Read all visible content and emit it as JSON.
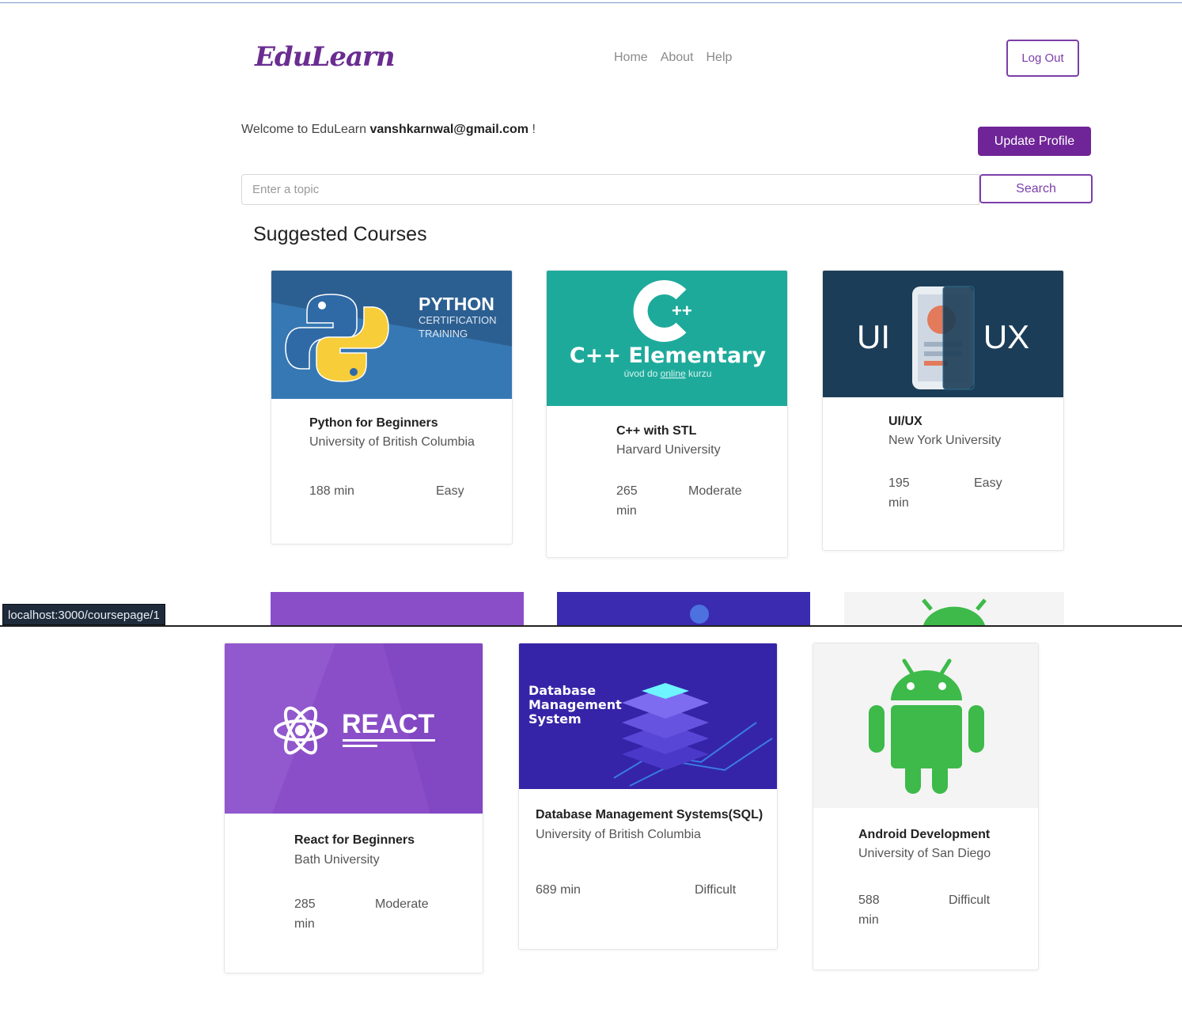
{
  "header": {
    "logo": "EduLearn",
    "nav": [
      "Home",
      "About",
      "Help"
    ],
    "logout_label": "Log Out"
  },
  "welcome": {
    "prefix": "Welcome to EduLearn ",
    "email": "vanshkarnwal@gmail.com",
    "suffix": " !"
  },
  "update_profile_label": "Update Profile",
  "search": {
    "placeholder": "Enter a topic",
    "button_label": "Search"
  },
  "section_title": "Suggested Courses",
  "status_url": "localhost:3000/coursepage/1",
  "courses": [
    {
      "title": "Python for Beginners",
      "university": "University of British Columbia",
      "duration": "188 min",
      "level": "Easy",
      "thumb": {
        "heading": "PYTHON",
        "line1": "CERTIFICATION",
        "line2": "TRAINING",
        "bg": "#2f6aa6"
      }
    },
    {
      "title": "C++ with STL",
      "university": "Harvard University",
      "duration": "265 min",
      "level": "Moderate",
      "thumb": {
        "heading": "C++ Elementary",
        "subtitle_prefix": "úvod do ",
        "subtitle_link": "online",
        "subtitle_suffix": " kurzu",
        "bg": "#1fa99b"
      }
    },
    {
      "title": "UI/UX",
      "university": "New York University",
      "duration": "195 min",
      "level": "Easy",
      "thumb": {
        "left": "UI",
        "right": "UX",
        "bg": "#1c3d57"
      }
    },
    {
      "title": "React for Beginners",
      "university": "Bath University",
      "duration": "285 min",
      "level": "Moderate",
      "thumb": {
        "heading": "REACT",
        "bg": "#8a4fc8"
      }
    },
    {
      "title": "Database Management Systems(SQL)",
      "university": "University of British Columbia",
      "duration": "689 min",
      "level": "Difficult",
      "thumb": {
        "line1": "Database",
        "line2": "Management",
        "line3": "System",
        "bg": "#3a2bb0"
      }
    },
    {
      "title": "Android Development",
      "university": "University of San Diego",
      "duration": "588 min",
      "level": "Difficult",
      "thumb": {
        "bg": "#f4f4f4",
        "accent": "#3dba4a"
      }
    }
  ]
}
